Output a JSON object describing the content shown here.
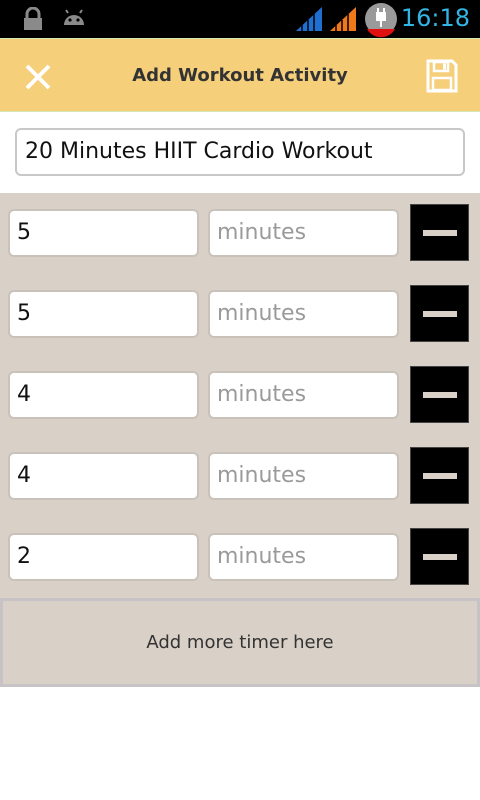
{
  "status_bar": {
    "time": "16:18",
    "icons": [
      "lock-icon",
      "android-icon",
      "signal-icon",
      "signal-alt-icon",
      "battery-charging-icon"
    ]
  },
  "action_bar": {
    "title": "Add Workout Activity",
    "close_icon": "close-icon",
    "save_icon": "save-icon",
    "bg_color": "#f5cf7a"
  },
  "workout": {
    "name": "20 Minutes HIIT Cardio Workout"
  },
  "timers": [
    {
      "value": "5",
      "unit_placeholder": "minutes"
    },
    {
      "value": "5",
      "unit_placeholder": "minutes"
    },
    {
      "value": "4",
      "unit_placeholder": "minutes"
    },
    {
      "value": "4",
      "unit_placeholder": "minutes"
    },
    {
      "value": "2",
      "unit_placeholder": "minutes"
    }
  ],
  "add_more": {
    "label": "Add more timer here"
  },
  "colors": {
    "timers_bg": "#d9d0c7",
    "accent": "#33b5e5"
  }
}
